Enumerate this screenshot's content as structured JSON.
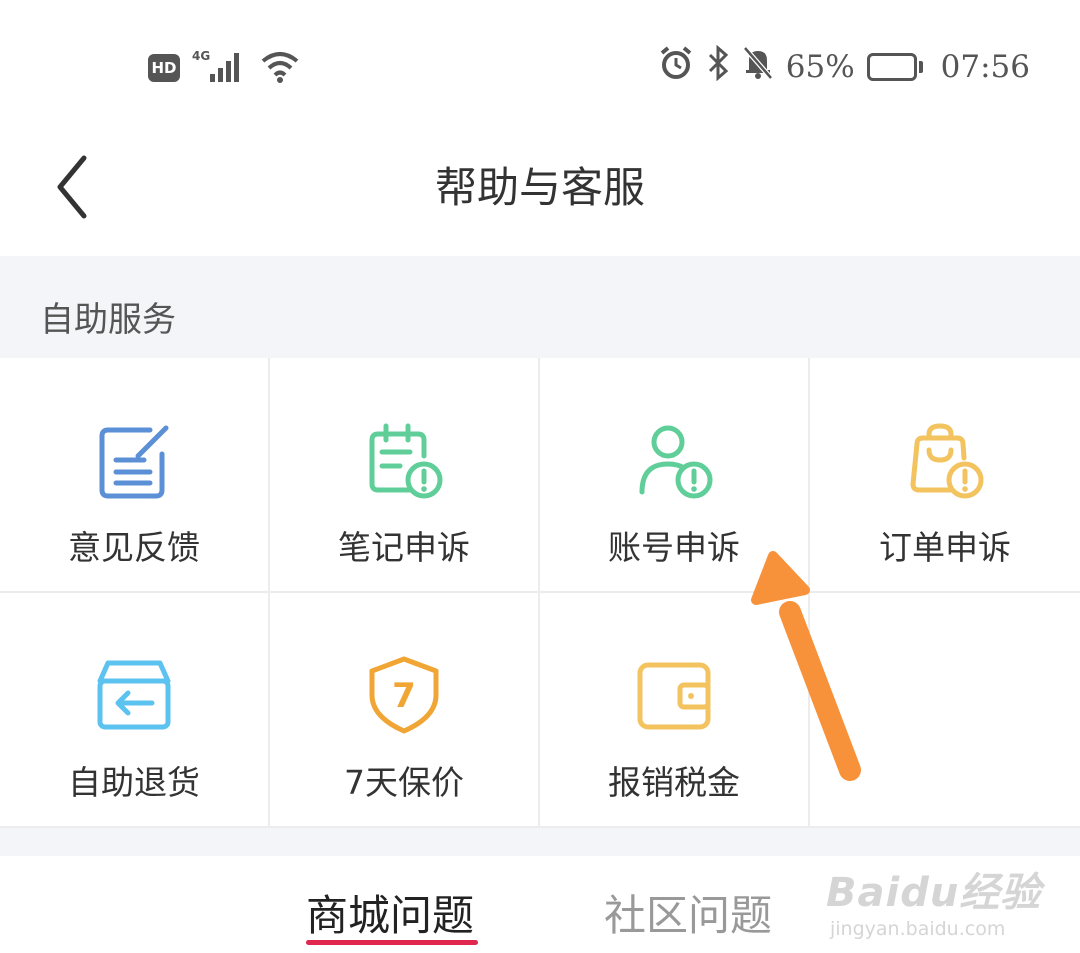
{
  "status_bar": {
    "hd_label": "HD",
    "network_label": "4G",
    "battery_percent": "65%",
    "battery_level": 0.65,
    "time": "07:56",
    "icons": [
      "signal-icon",
      "wifi-icon",
      "alarm-icon",
      "bluetooth-icon",
      "mute-icon",
      "battery-icon"
    ]
  },
  "header": {
    "title": "帮助与客服",
    "back_icon": "chevron-left-icon"
  },
  "self_service": {
    "section_title": "自助服务",
    "items": [
      {
        "label": "意见反馈",
        "icon": "feedback-icon",
        "color": "#5b8fd6"
      },
      {
        "label": "笔记申诉",
        "icon": "note-appeal-icon",
        "color": "#5fce98"
      },
      {
        "label": "账号申诉",
        "icon": "account-appeal-icon",
        "color": "#5fce98"
      },
      {
        "label": "订单申诉",
        "icon": "order-appeal-icon",
        "color": "#f2c35f"
      },
      {
        "label": "自助退货",
        "icon": "return-box-icon",
        "color": "#5cc2ef"
      },
      {
        "label": "7天保价",
        "icon": "price-protect-shield-icon",
        "color": "#f0a535",
        "badge": "7"
      },
      {
        "label": "报销税金",
        "icon": "wallet-icon",
        "color": "#f2c35f"
      }
    ]
  },
  "tabs": [
    {
      "label": "商城问题",
      "active": true
    },
    {
      "label": "社区问题",
      "active": false
    }
  ],
  "colors": {
    "accent": "#e0284f",
    "annotation_arrow": "#f7913a",
    "section_bg": "#f3f5f8"
  },
  "watermark": {
    "logo": "Baidu经验",
    "url": "jingyan.baidu.com"
  }
}
